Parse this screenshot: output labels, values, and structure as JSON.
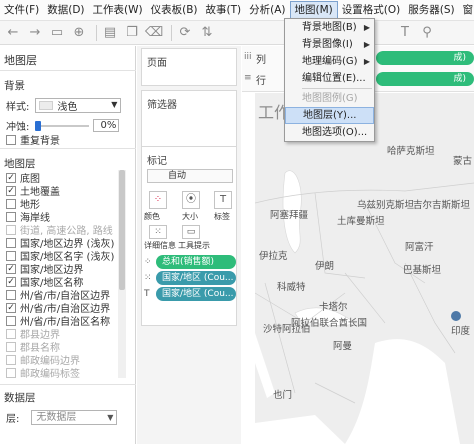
{
  "menubar": {
    "items": [
      "文件(F)",
      "数据(D)",
      "工作表(W)",
      "仪表板(B)",
      "故事(T)",
      "分析(A)",
      "地图(M)",
      "设置格式(O)",
      "服务器(S)",
      "窗口"
    ]
  },
  "map_menu": {
    "items": [
      {
        "label": "背景地图(B)",
        "submenu": true,
        "enabled": true
      },
      {
        "label": "背景图像(I)",
        "submenu": true,
        "enabled": true
      },
      {
        "label": "地理编码(G)",
        "submenu": true,
        "enabled": true
      },
      {
        "label": "编辑位置(E)...",
        "submenu": false,
        "enabled": true
      },
      {
        "label": "地图图例(G)",
        "submenu": false,
        "enabled": false
      },
      {
        "label": "地图层(Y)...",
        "submenu": false,
        "enabled": true,
        "highlighted": true
      },
      {
        "label": "地图选项(O)...",
        "submenu": false,
        "enabled": true
      }
    ]
  },
  "left_pane": {
    "title": "地图层",
    "background": {
      "heading": "背景",
      "style_label": "样式:",
      "style_value": "浅色",
      "wash_label": "冲蚀:",
      "wash_value": "0%",
      "repeat_label": "重复背景"
    },
    "layers": {
      "heading": "地图层",
      "items": [
        {
          "label": "底图",
          "checked": true,
          "enabled": true
        },
        {
          "label": "土地覆盖",
          "checked": true,
          "enabled": true
        },
        {
          "label": "地形",
          "checked": false,
          "enabled": true
        },
        {
          "label": "海岸线",
          "checked": false,
          "enabled": true
        },
        {
          "label": "街道, 高速公路, 路线",
          "checked": false,
          "enabled": false
        },
        {
          "label": "国家/地区边界  (浅灰)",
          "checked": false,
          "enabled": true
        },
        {
          "label": "国家/地区名字  (浅灰)",
          "checked": false,
          "enabled": true
        },
        {
          "label": "国家/地区边界",
          "checked": true,
          "enabled": true
        },
        {
          "label": "国家/地区名称",
          "checked": true,
          "enabled": true
        },
        {
          "label": "州/省/市/自治区边界",
          "checked": false,
          "enabled": true
        },
        {
          "label": "州/省/市/自治区边界",
          "checked": true,
          "enabled": true
        },
        {
          "label": "州/省/市/自治区名称",
          "checked": false,
          "enabled": true
        },
        {
          "label": "郡县边界",
          "checked": false,
          "enabled": false
        },
        {
          "label": "郡县名称",
          "checked": false,
          "enabled": false
        },
        {
          "label": "邮政编码边界",
          "checked": false,
          "enabled": false
        },
        {
          "label": "邮政编码标签",
          "checked": false,
          "enabled": false
        }
      ]
    },
    "data_layer": {
      "heading": "数据层",
      "layer_label": "层:",
      "layer_value": "无数据层"
    }
  },
  "cards": {
    "pages": "页面",
    "filters": "筛选器",
    "marks": "标记",
    "marks_type": "自动",
    "mark_buttons": [
      "颜色",
      "大小",
      "标签",
      "详细信息",
      "工具提示"
    ],
    "mark_pills": [
      "总和(销售额)",
      "国家/地区 (Cou...",
      "国家/地区 (Cou..."
    ]
  },
  "shelves": {
    "columns_label": "列",
    "rows_label": "行",
    "columns_pill": "成)",
    "rows_pill": "成)"
  },
  "sheet_title": "工作",
  "map_labels": [
    "哈萨克斯坦",
    "蒙古",
    "阿塞拜疆",
    "乌兹别克斯坦",
    "土库曼斯坦",
    "吉尔吉斯斯坦",
    "阿富汗",
    "伊拉克",
    "伊朗",
    "巴基斯坦",
    "科威特",
    "卡塔尔",
    "阿拉伯联合酋长国",
    "沙特阿拉伯",
    "阿曼",
    "也门",
    "印度"
  ],
  "colors": {
    "accent_green": "#2ebc7a",
    "accent_teal": "#3a9bab",
    "menu_highlight": "#cde0f7"
  }
}
